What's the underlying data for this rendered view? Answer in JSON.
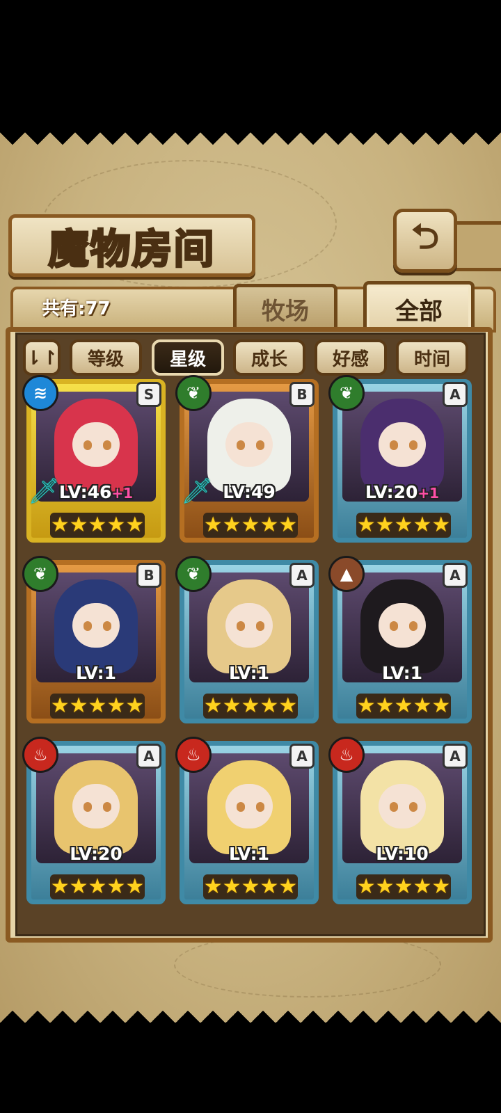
{
  "header": {
    "title": "魔物房间",
    "back_icon": "return-arrow-icon"
  },
  "summary": {
    "count_label": "共有:77"
  },
  "tabs": [
    {
      "label": "牧场",
      "active": false
    },
    {
      "label": "全部",
      "active": true
    }
  ],
  "sort": {
    "toggle_icon": "sort-order-icon",
    "buttons": [
      {
        "label": "等级",
        "active": false
      },
      {
        "label": "星级",
        "active": true
      },
      {
        "label": "成长",
        "active": false
      },
      {
        "label": "好感",
        "active": false
      },
      {
        "label": "时间",
        "active": false
      }
    ]
  },
  "monsters": [
    {
      "element": "water",
      "rank": "S",
      "level": "LV:46",
      "bonus": "+1",
      "stars": 5,
      "weapon": true,
      "frame": "gold"
    },
    {
      "element": "nature",
      "rank": "B",
      "level": "LV:49",
      "bonus": "",
      "stars": 5,
      "weapon": true,
      "frame": "bronze"
    },
    {
      "element": "nature",
      "rank": "A",
      "level": "LV:20",
      "bonus": "+1",
      "stars": 5,
      "weapon": false,
      "frame": "blue"
    },
    {
      "element": "nature",
      "rank": "B",
      "level": "LV:1",
      "bonus": "",
      "stars": 5,
      "weapon": false,
      "frame": "bronze"
    },
    {
      "element": "nature",
      "rank": "A",
      "level": "LV:1",
      "bonus": "",
      "stars": 5,
      "weapon": false,
      "frame": "blue"
    },
    {
      "element": "earth",
      "rank": "A",
      "level": "LV:1",
      "bonus": "",
      "stars": 5,
      "weapon": false,
      "frame": "blue"
    },
    {
      "element": "fire",
      "rank": "A",
      "level": "LV:20",
      "bonus": "",
      "stars": 5,
      "weapon": false,
      "frame": "blue"
    },
    {
      "element": "fire",
      "rank": "A",
      "level": "LV:1",
      "bonus": "",
      "stars": 5,
      "weapon": false,
      "frame": "blue"
    },
    {
      "element": "fire",
      "rank": "A",
      "level": "LV:10",
      "bonus": "",
      "stars": 5,
      "weapon": false,
      "frame": "blue"
    }
  ],
  "colors": {
    "water": "#1e88d8",
    "nature": "#2f7d2c",
    "earth": "#8a4a2a",
    "fire": "#c8281e"
  }
}
